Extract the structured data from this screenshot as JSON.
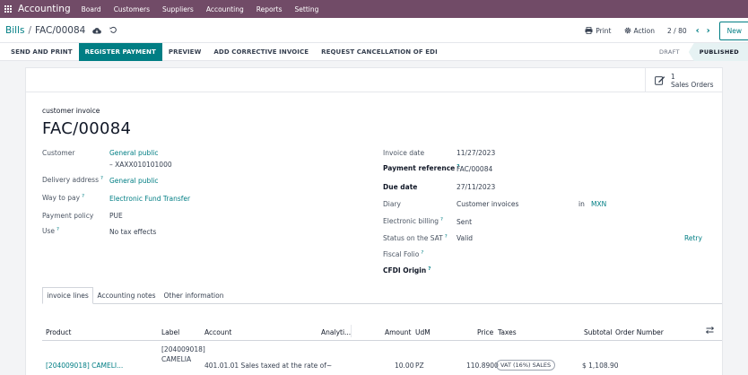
{
  "navbar": {
    "brand": "Accounting",
    "menu": [
      "Board",
      "Customers",
      "Suppliers",
      "Accounting",
      "Reports",
      "Setting"
    ]
  },
  "controlpanel": {
    "breadcrumb_parent": "Bills",
    "breadcrumb_sep": "/",
    "record": "FAC/00084",
    "print_label": "Print",
    "action_label": "Action",
    "pager": "2 / 80",
    "new_label": "New"
  },
  "statusbar": {
    "buttons": [
      "SEND AND PRINT",
      "REGISTER PAYMENT",
      "PREVIEW",
      "ADD CORRECTIVE INVOICE",
      "REQUEST CANCELLATION OF EDI"
    ],
    "states": [
      "DRAFT",
      "PUBLISHED"
    ],
    "active_state": "PUBLISHED"
  },
  "smart_button": {
    "count": "1",
    "label": "Sales Orders"
  },
  "form": {
    "kind": "customer invoice",
    "name": "FAC/00084",
    "left": {
      "customer_label": "Customer",
      "customer_value": "General public",
      "customer_vat": "– XAXX010101000",
      "delivery_label": "Delivery address",
      "delivery_value": "General public",
      "way_label": "Way to pay",
      "way_value": "Electronic Fund Transfer",
      "policy_label": "Payment policy",
      "policy_value": "PUE",
      "use_label": "Use",
      "use_value": "No tax effects"
    },
    "right": {
      "date_label": "Invoice date",
      "date_value": "11/27/2023",
      "ref_label": "Payment reference",
      "ref_value": "FAC/00084",
      "due_label": "Due date",
      "due_value": "27/11/2023",
      "diary_label": "Diary",
      "diary_value": "Customer invoices",
      "diary_in": "in",
      "currency": "MXN",
      "ebill_label": "Electronic billing",
      "ebill_value": "Sent",
      "sat_label": "Status on the SAT",
      "sat_value": "Valid",
      "retry_label": "Retry",
      "folio_label": "Fiscal Folio",
      "cfdi_label": "CFDI Origin",
      "help_mark": "?"
    }
  },
  "tabs": [
    "invoice lines",
    "Accounting notes",
    "Other information"
  ],
  "lines": {
    "headers": {
      "product": "Product",
      "label": "Label",
      "account": "Account",
      "analytic": "Analyti...",
      "amount": "Amount",
      "udm": "UdM",
      "price": "Price",
      "taxes": "Taxes",
      "subtotal": "Subtotal",
      "order": "Order Number"
    },
    "rows": [
      {
        "product": "[204009018] CAMELI...",
        "label_code": "[204009018]",
        "label_name": "CAMELIA",
        "account": "401.01.01 Sales taxed at the rate of~",
        "amount": "10.00",
        "udm": "PZ",
        "price": "110.8900",
        "tax": "VAT (16%) SALES",
        "subtotal": "$ 1,108.90"
      }
    ]
  },
  "colors": {
    "brand": "#714b67",
    "accent": "#017e84"
  }
}
